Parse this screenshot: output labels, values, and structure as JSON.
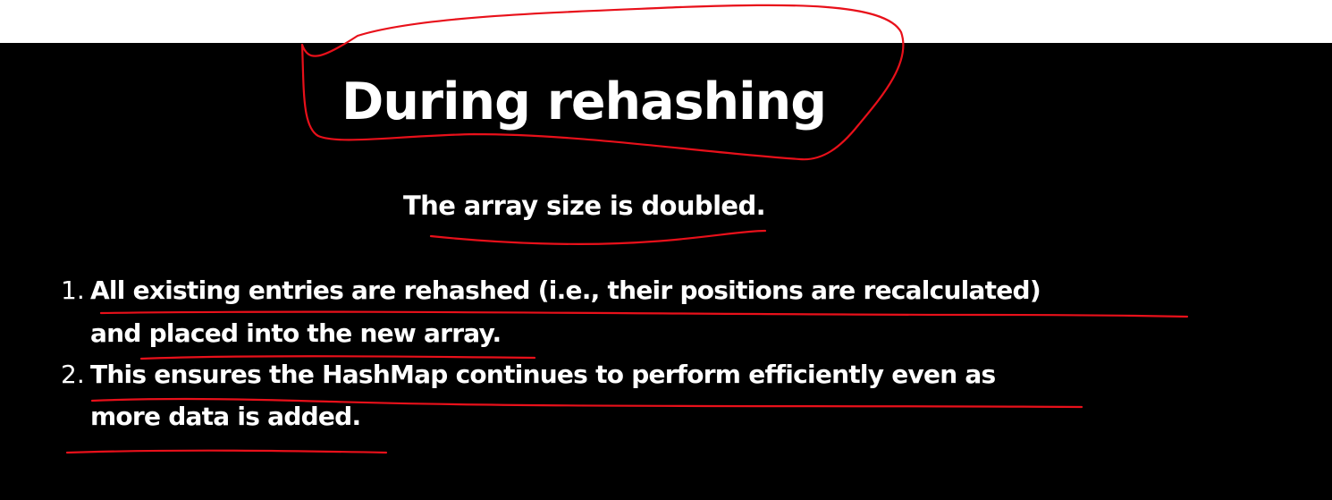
{
  "slide": {
    "title": "During rehashing",
    "subtitle": "The array size is doubled.",
    "items": [
      {
        "number": "1.",
        "line1": "All existing entries are rehashed (i.e., their positions are recalculated)",
        "line2": "and placed into the new array."
      },
      {
        "number": "2.",
        "line1": "This ensures the HashMap continues to perform efficiently even as",
        "line2": "more data is added."
      }
    ]
  },
  "colors": {
    "background": "#000000",
    "text": "#ffffff",
    "annotation_ink": "#e8101a"
  }
}
